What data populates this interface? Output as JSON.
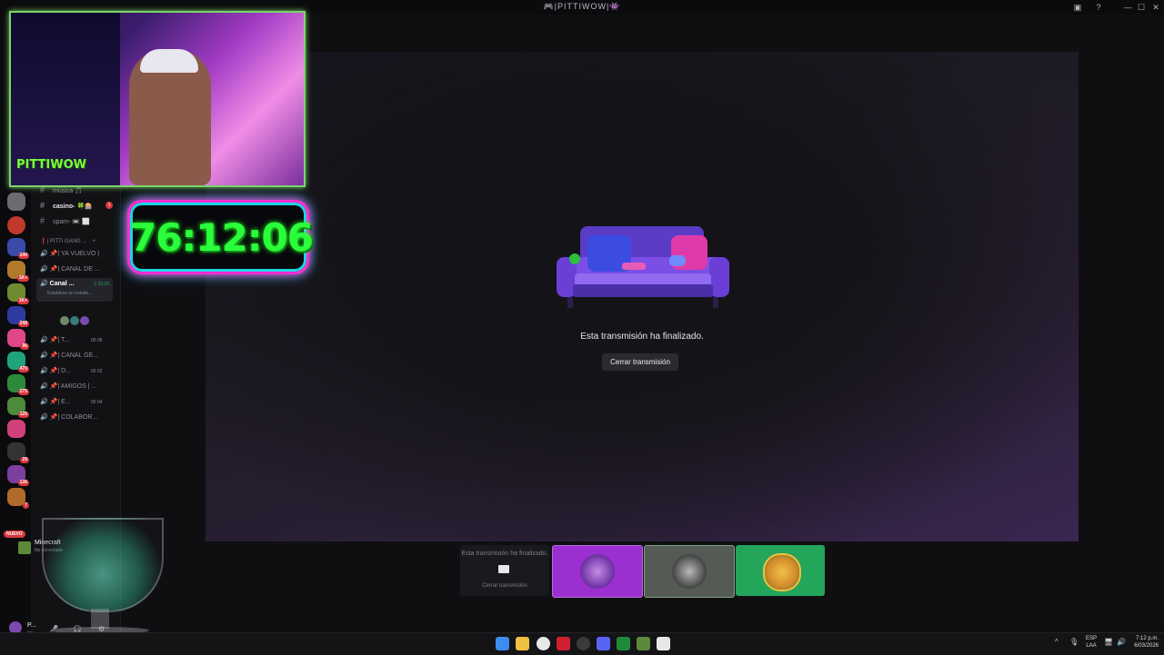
{
  "window": {
    "title": "🎮|PITTIWOW|👾"
  },
  "rail": {
    "badges": [
      "140",
      "1K+",
      "1K+",
      "248",
      "96",
      "470",
      "275",
      "125",
      "29",
      "136",
      "7"
    ],
    "new_label": "NUEVO"
  },
  "channels": {
    "text": [
      {
        "label": "música 🎵",
        "badge": ""
      },
      {
        "label": "casino- 🍀🎰",
        "badge": "1"
      },
      {
        "label": "spam- 📼 ⬜",
        "badge": ""
      }
    ],
    "category": "| PITTI GANG ...",
    "voice": [
      {
        "label": "| YA VUELVO |",
        "count": ""
      },
      {
        "label": "| CANAL DE ...",
        "count": ""
      },
      {
        "label": "Canal ...",
        "count": "1:33:26",
        "sub": "Establece un estado...",
        "selected": true
      },
      {
        "label": "| T...",
        "count": "00 06"
      },
      {
        "label": "| CANAL GE...",
        "count": ""
      },
      {
        "label": "| D...",
        "count": "00 02"
      },
      {
        "label": "| AMIGOS | ...",
        "count": ""
      },
      {
        "label": "| E...",
        "count": "00 04"
      },
      {
        "label": "| COLABOR...",
        "count": ""
      }
    ]
  },
  "activity": {
    "game": "Minecraft",
    "status": "No conectado"
  },
  "user": {
    "name": "P...",
    "status": "leu..."
  },
  "stream": {
    "ended_text": "Esta transmisión ha finalizado.",
    "close_label": "Cerrar transmisión"
  },
  "thumbs": {
    "first_text": "Esta transmisión ha finalizado.",
    "first_close": "Cerrar transmisión"
  },
  "overlay": {
    "timer": "76:12:06",
    "cam_brand": "PITTIWOW"
  },
  "taskbar": {
    "lang1": "ESP",
    "lang2": "LAA",
    "time": "7:12 p.m.",
    "date": "6/03/2026"
  },
  "colors": {
    "accent": "#5865f2",
    "green": "#23a55a",
    "red": "#da373c",
    "purple_tile": "#9b2fd0"
  }
}
